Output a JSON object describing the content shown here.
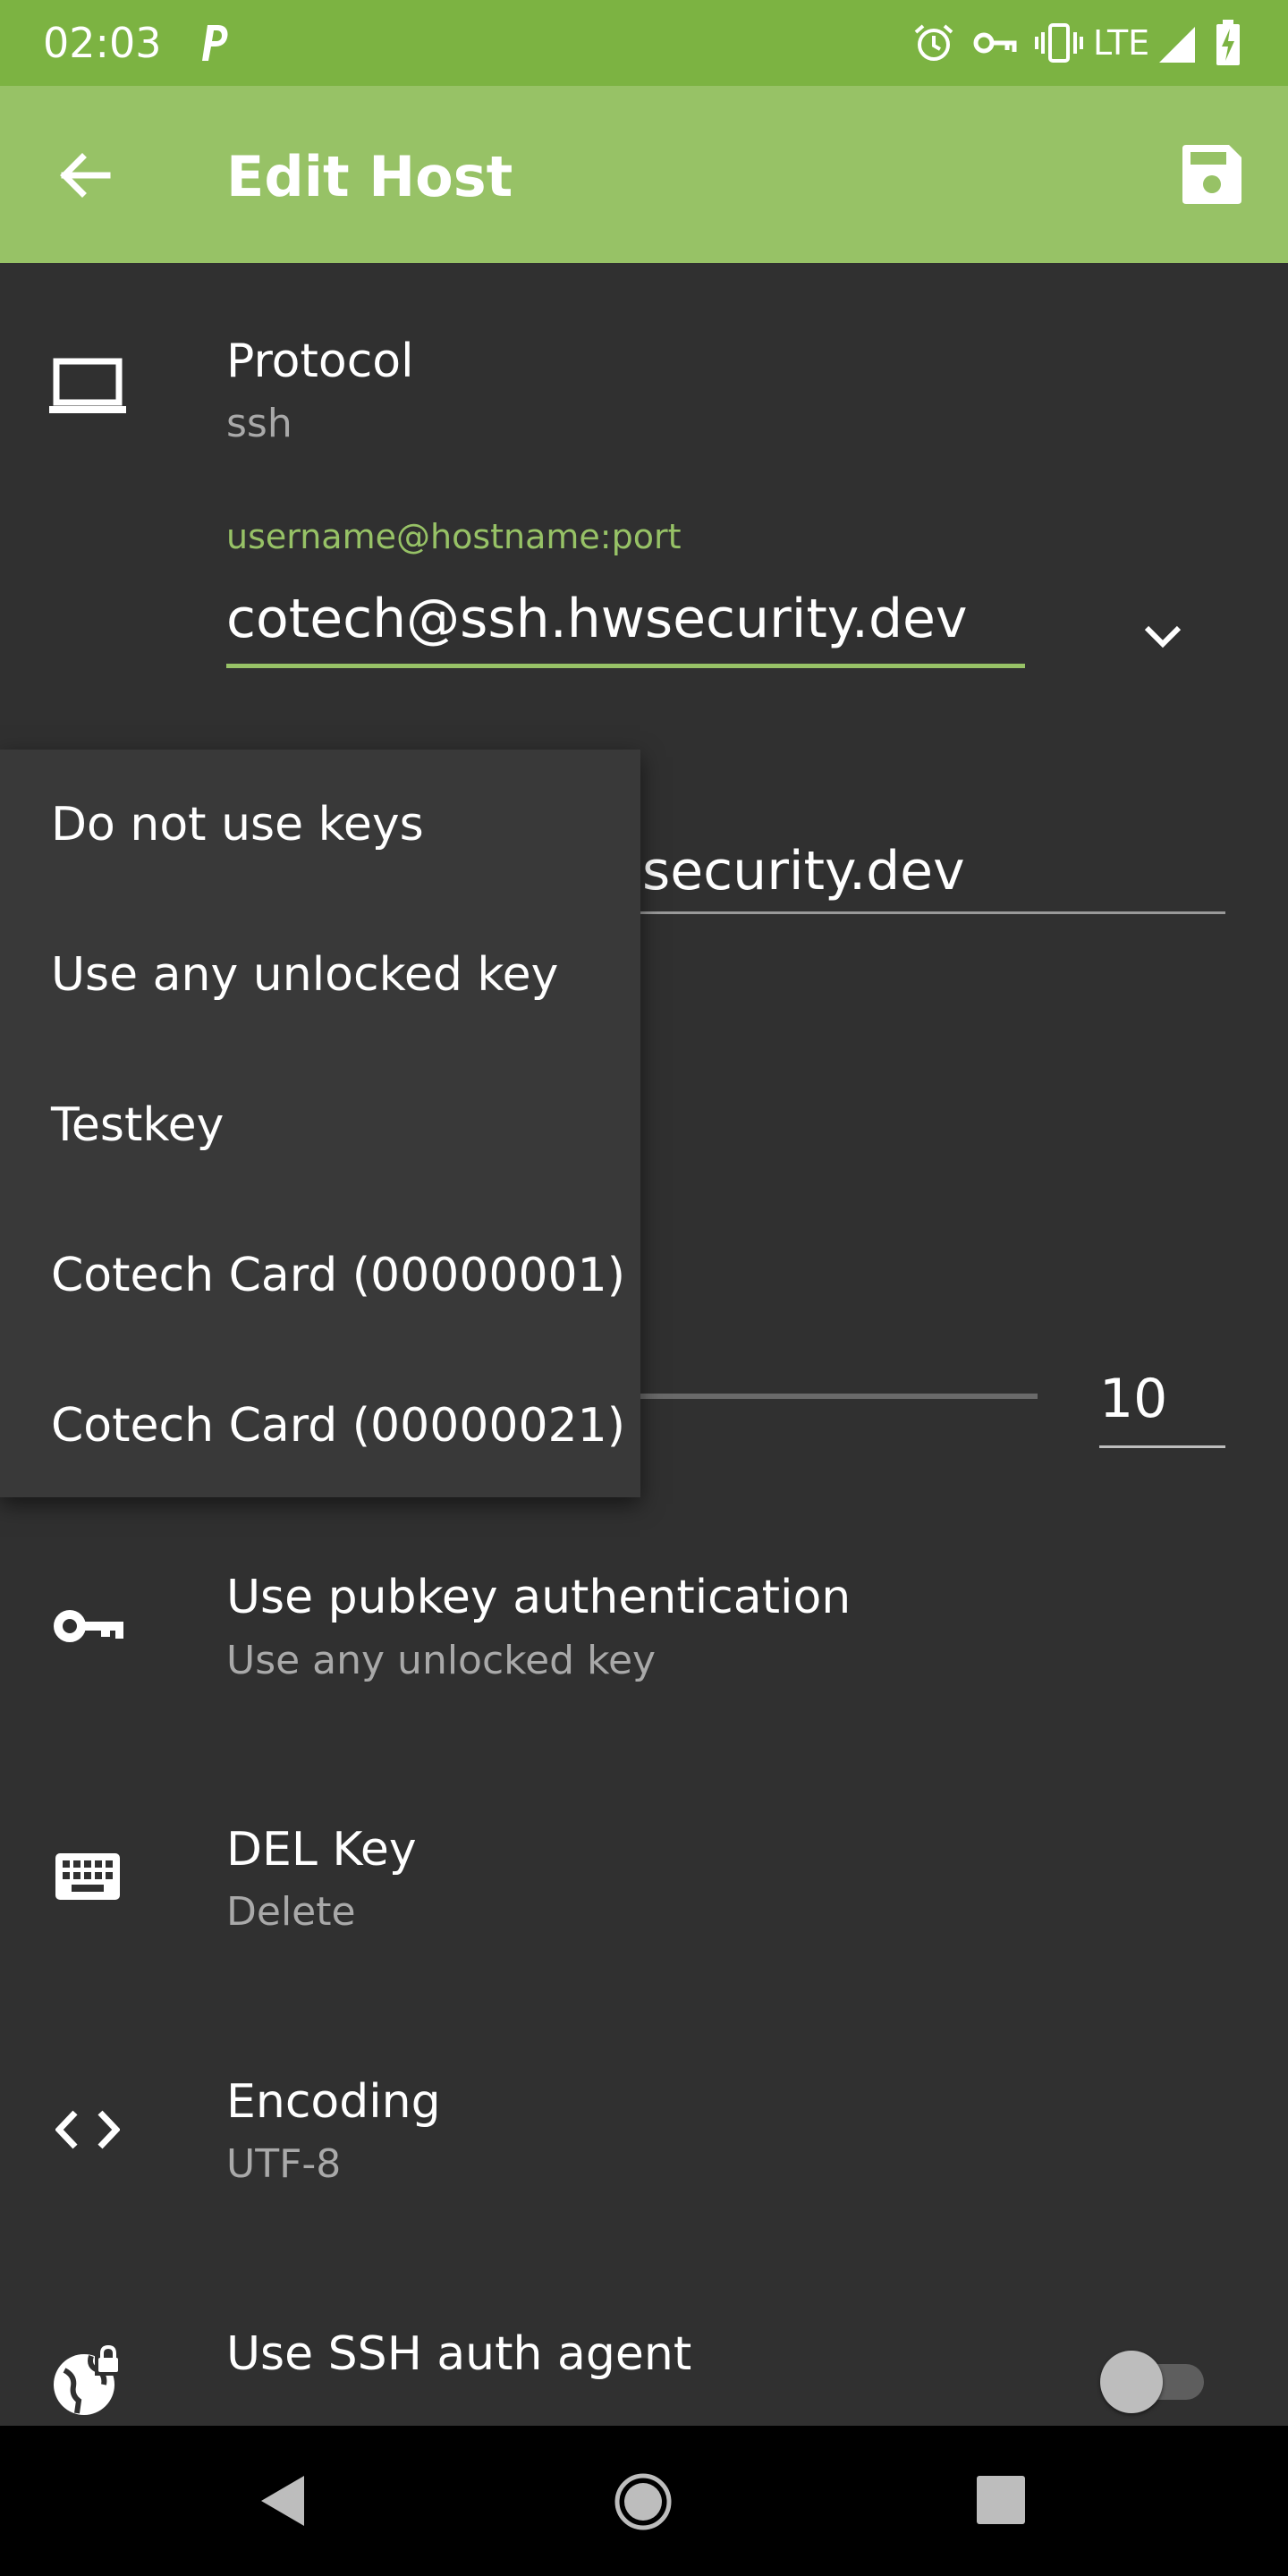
{
  "status_bar": {
    "time": "02:03",
    "network": "LTE",
    "icons": [
      "parking-icon",
      "alarm-icon",
      "vpn-key-icon",
      "vibrate-icon",
      "signal-icon",
      "battery-charging-icon"
    ]
  },
  "app_bar": {
    "title": "Edit Host",
    "back_icon": "arrow-back-icon",
    "save_icon": "save-icon"
  },
  "protocol": {
    "title": "Protocol",
    "value": "ssh",
    "icon": "laptop-icon"
  },
  "host_field": {
    "label": "username@hostname:port",
    "value": "cotech@ssh.hwsecurity.dev"
  },
  "nickname_field": {
    "partial_value": "security.dev"
  },
  "font_size_field": {
    "value": "10"
  },
  "pubkey_menu": {
    "items": [
      "Do not use keys",
      "Use any unlocked key",
      "Testkey",
      "Cotech Card (00000001)",
      "Cotech Card (00000021)"
    ]
  },
  "settings": {
    "pubkey": {
      "title": "Use pubkey authentication",
      "value": "Use any unlocked key",
      "icon": "key-icon"
    },
    "del_key": {
      "title": "DEL Key",
      "value": "Delete",
      "icon": "keyboard-icon"
    },
    "encoding": {
      "title": "Encoding",
      "value": "UTF-8",
      "icon": "code-icon"
    },
    "auth_agent": {
      "title": "Use SSH auth agent",
      "icon": "globe-lock-icon",
      "enabled": false
    }
  },
  "colors": {
    "status_bar": "#7cb342",
    "app_bar": "#97c266",
    "accent": "#97c266",
    "background": "#303030",
    "popup": "#393939"
  },
  "nav_bar": {
    "icons": [
      "back-triangle-icon",
      "home-circle-icon",
      "recents-square-icon"
    ]
  }
}
